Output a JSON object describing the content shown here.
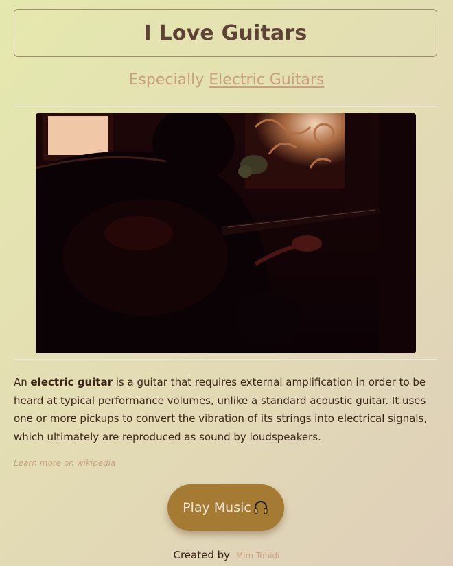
{
  "header": {
    "title": "I Love Guitars",
    "subtitle_prefix": "Especially",
    "subtitle_link": "Electric Guitars"
  },
  "image": {
    "alt": "Silhouette of a person playing an electric guitar by a window"
  },
  "description": {
    "part1": "An ",
    "bold": "electric guitar",
    "part2": " is a guitar that requires external amplification in order to be heard at typical performance volumes, unlike a standard acoustic guitar. It uses one or more pickups to convert the vibration of its strings into electrical signals, which ultimately are reproduced as sound by loudspeakers."
  },
  "learn_more": "Learn more on wikipedia",
  "play_button": {
    "label": "Play Music",
    "icon": "headphones-icon"
  },
  "footer": {
    "prefix": "Created by",
    "author": "Mim Tohidi"
  },
  "colors": {
    "accent": "#c8a07f",
    "button": "#a57a32",
    "title": "#5e4237",
    "text": "#3b2418"
  }
}
